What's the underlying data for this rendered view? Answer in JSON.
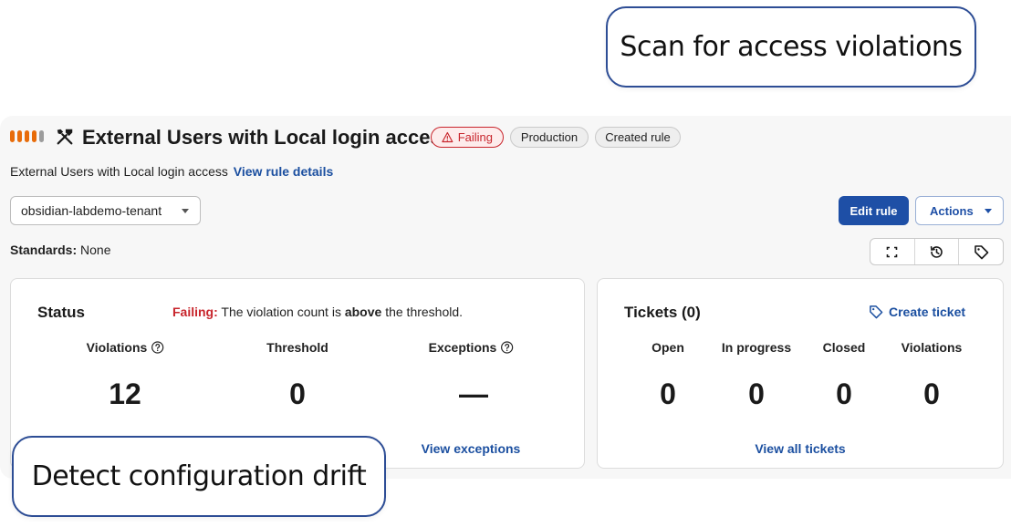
{
  "callouts": {
    "top": "Scan for access violations",
    "bottom": "Detect configuration drift"
  },
  "rule": {
    "title": "External Users with Local login access",
    "description": "External Users with Local login access",
    "view_details_link": "View rule details",
    "severity_level": 4,
    "severity_max": 5,
    "badges": {
      "status": "Failing",
      "environment": "Production",
      "origin": "Created rule"
    }
  },
  "toolbar": {
    "tenant_value": "obsidian-labdemo-tenant",
    "edit_label": "Edit rule",
    "actions_label": "Actions",
    "icons": [
      "expand-icon",
      "history-icon",
      "tag-icon"
    ]
  },
  "standards": {
    "label": "Standards:",
    "value": "None"
  },
  "status": {
    "title": "Status",
    "state": "Failing:",
    "message_pre": "The violation count is",
    "message_bold": "above",
    "message_post": "the threshold.",
    "columns": [
      {
        "label": "Violations",
        "value": "12",
        "help": true
      },
      {
        "label": "Threshold",
        "value": "0",
        "help": false
      },
      {
        "label": "Exceptions",
        "value": "—",
        "help": true
      }
    ],
    "view_exceptions": "View exceptions"
  },
  "tickets": {
    "title": "Tickets (0)",
    "create_label": "Create ticket",
    "columns": [
      {
        "label": "Open",
        "value": "0"
      },
      {
        "label": "In progress",
        "value": "0"
      },
      {
        "label": "Closed",
        "value": "0"
      },
      {
        "label": "Violations",
        "value": "0"
      }
    ],
    "view_all": "View all tickets"
  },
  "colors": {
    "accent": "#1e4fa6",
    "failing": "#c8252c",
    "severity": "#e86c0a",
    "callout_border": "#2d4d95"
  }
}
